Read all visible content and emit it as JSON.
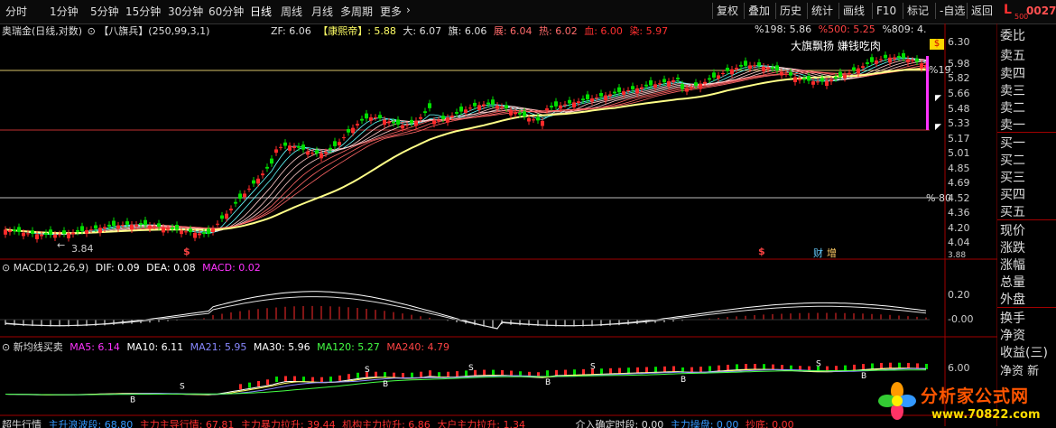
{
  "topbar": {
    "tabs": [
      "分时",
      "1分钟",
      "5分钟",
      "15分钟",
      "30分钟",
      "60分钟",
      "日线",
      "周线",
      "月线",
      "多周期",
      "更多"
    ],
    "buttons": [
      "复权",
      "叠加",
      "历史",
      "统计",
      "画线",
      "F10",
      "标记",
      "-自选",
      "返回"
    ],
    "badge": "L",
    "badge_sub": "500",
    "code": "0027"
  },
  "main_panel": {
    "stock": "奥瑞金(日线,对数)",
    "indicator": "【八旗兵】(250,99,3,1)",
    "zf": "ZF: 6.06",
    "kangxi": "【康熙帝】: 5.88",
    "da": "大: 6.07",
    "qi": "旗: 6.06",
    "zhan": "展: 6.04",
    "re": "热: 6.02",
    "xue": "血: 6.00",
    "ran": "染: 5.97",
    "pct198": "%198: 5.86",
    "pct500": "%500: 5.25",
    "pct809": "%809: 4.",
    "tag_text": "大旗飘扬 嫌钱吃肉",
    "pct19": "%19.",
    "pct80": "% 80",
    "low_label": "3.84",
    "markers": [
      "$",
      "$",
      "财",
      "增"
    ],
    "scale": [
      "6.30",
      "5.98",
      "5.82",
      "5.66",
      "5.48",
      "5.33",
      "5.17",
      "5.01",
      "4.85",
      "4.69",
      "4.52",
      "4.36",
      "4.20",
      "4.04",
      "3.88"
    ]
  },
  "macd_panel": {
    "name": "MACD(12,26,9)",
    "dif": "DIF: 0.09",
    "dea": "DEA: 0.08",
    "macd": "MACD: 0.02",
    "scale": [
      "0.20",
      "-0.00"
    ]
  },
  "ma_panel": {
    "name": "新均线买卖",
    "ma5": "MA5: 6.14",
    "ma10": "MA10: 6.11",
    "ma21": "MA21: 5.95",
    "ma30": "MA30: 5.96",
    "ma120": "MA120: 5.27",
    "ma240": "MA240: 4.79",
    "scale": [
      "6.00"
    ],
    "buy_marks": [
      "S",
      "B"
    ]
  },
  "bottom_panel": {
    "name": "超牛行情",
    "items": [
      "主升浪波段: 68.80",
      "主力主导行情: 67.81",
      "主力暴力拉升: 39.44",
      "机构主力拉升: 6.86",
      "大户主力拉升: 1.34"
    ],
    "extra": [
      "介入确定时段: 0.00",
      "主力操盘: 0.00",
      "抄底: 0.00"
    ]
  },
  "orderbook": [
    "委比",
    "卖五",
    "卖四",
    "卖三",
    "卖二",
    "卖一",
    "买一",
    "买二",
    "买三",
    "买四",
    "买五",
    "现价",
    "涨跌",
    "涨幅",
    "总量",
    "外盘",
    "换手",
    "净资",
    "收益(三)",
    "净资 新"
  ],
  "watermark": {
    "site": "分析家公式网",
    "url": "www.70822.com"
  },
  "colors": {
    "up": "#ff2a2a",
    "down": "#00e000",
    "yellow": "#ffff66",
    "cyan": "#66ffff",
    "magenta": "#ff33ff"
  }
}
